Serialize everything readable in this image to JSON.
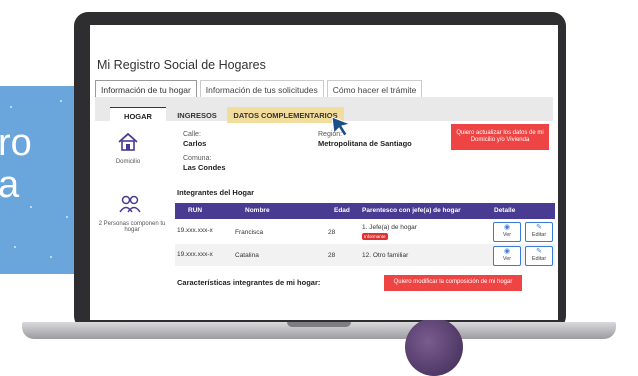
{
  "page": {
    "title": "Mi Registro Social de Hogares",
    "background_text": [
      "ro",
      "a"
    ],
    "tabs": [
      {
        "label": "Información de tu hogar"
      },
      {
        "label": "Información de tus solicitudes"
      },
      {
        "label": "Cómo hacer el trámite"
      }
    ],
    "subtabs": [
      {
        "label": "HOGAR"
      },
      {
        "label": "INGRESOS"
      },
      {
        "label": "DATOS COMPLEMENTARIOS"
      }
    ]
  },
  "domicilio": {
    "icon_label": "Domicilio",
    "calle_label": "Calle:",
    "calle_value": "Carlos",
    "comuna_label": "Comuna:",
    "comuna_value": "Las Condes",
    "region_label": "Región:",
    "region_value": "Metropolitana de Santiago",
    "update_button": "Quiero actualizar los datos de mi Domicilio y/o Vivienda"
  },
  "integrantes": {
    "section_title": "Integrantes del Hogar",
    "count_label": "2 Personas componen tu hogar",
    "columns": [
      "RUN",
      "Nombre",
      "Edad",
      "Parentesco con jefe(a) de hogar",
      "Detalle"
    ],
    "rows": [
      {
        "run": "19.xxx.xxx-x",
        "nombre": "Francisca",
        "edad": "28",
        "parentesco": "1. Jefe(a) de hogar",
        "badge": "Informante"
      },
      {
        "run": "19.xxx.xxx-x",
        "nombre": "Catalina",
        "edad": "28",
        "parentesco": "12. Otro familiar",
        "badge": ""
      }
    ],
    "ver_label": "Ver",
    "editar_label": "Editar"
  },
  "caracteristicas": {
    "title": "Características integrantes de mi hogar:",
    "modify_button": "Quiero modificar la composición de mi hogar"
  },
  "colors": {
    "accent_purple": "#4a3b92",
    "red_button": "#e44444",
    "active_subtab": "#f3dd9c",
    "side_panel_blue": "#6aa6db"
  }
}
